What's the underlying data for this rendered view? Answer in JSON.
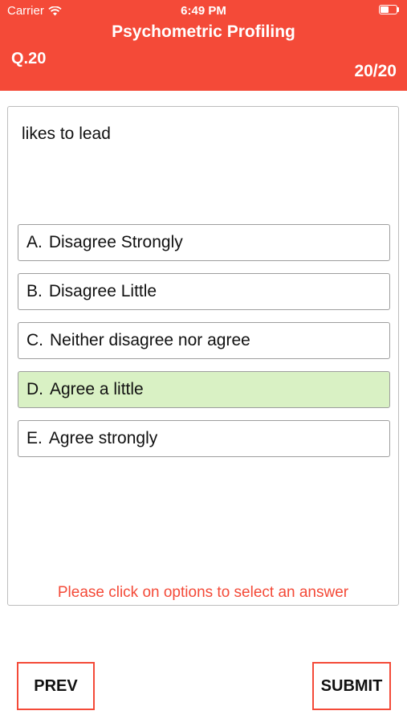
{
  "status_bar": {
    "carrier": "Carrier",
    "time": "6:49 PM"
  },
  "header": {
    "title": "Psychometric Profiling",
    "question_number": "Q.20",
    "counter": "20/20"
  },
  "question": {
    "text": "likes to lead",
    "options": [
      {
        "letter": "A.",
        "label": "Disagree Strongly",
        "selected": false
      },
      {
        "letter": "B.",
        "label": "Disagree Little",
        "selected": false
      },
      {
        "letter": "C.",
        "label": "Neither disagree nor agree",
        "selected": false
      },
      {
        "letter": "D.",
        "label": "Agree a little",
        "selected": true
      },
      {
        "letter": "E.",
        "label": "Agree strongly",
        "selected": false
      }
    ],
    "hint": "Please click on options to select an answer"
  },
  "buttons": {
    "prev": "PREV",
    "submit": "SUBMIT"
  },
  "colors": {
    "accent": "#f44a38",
    "selected_option": "#d9f1c4"
  },
  "icons": {
    "wifi": "wifi-icon",
    "battery": "battery-icon"
  }
}
